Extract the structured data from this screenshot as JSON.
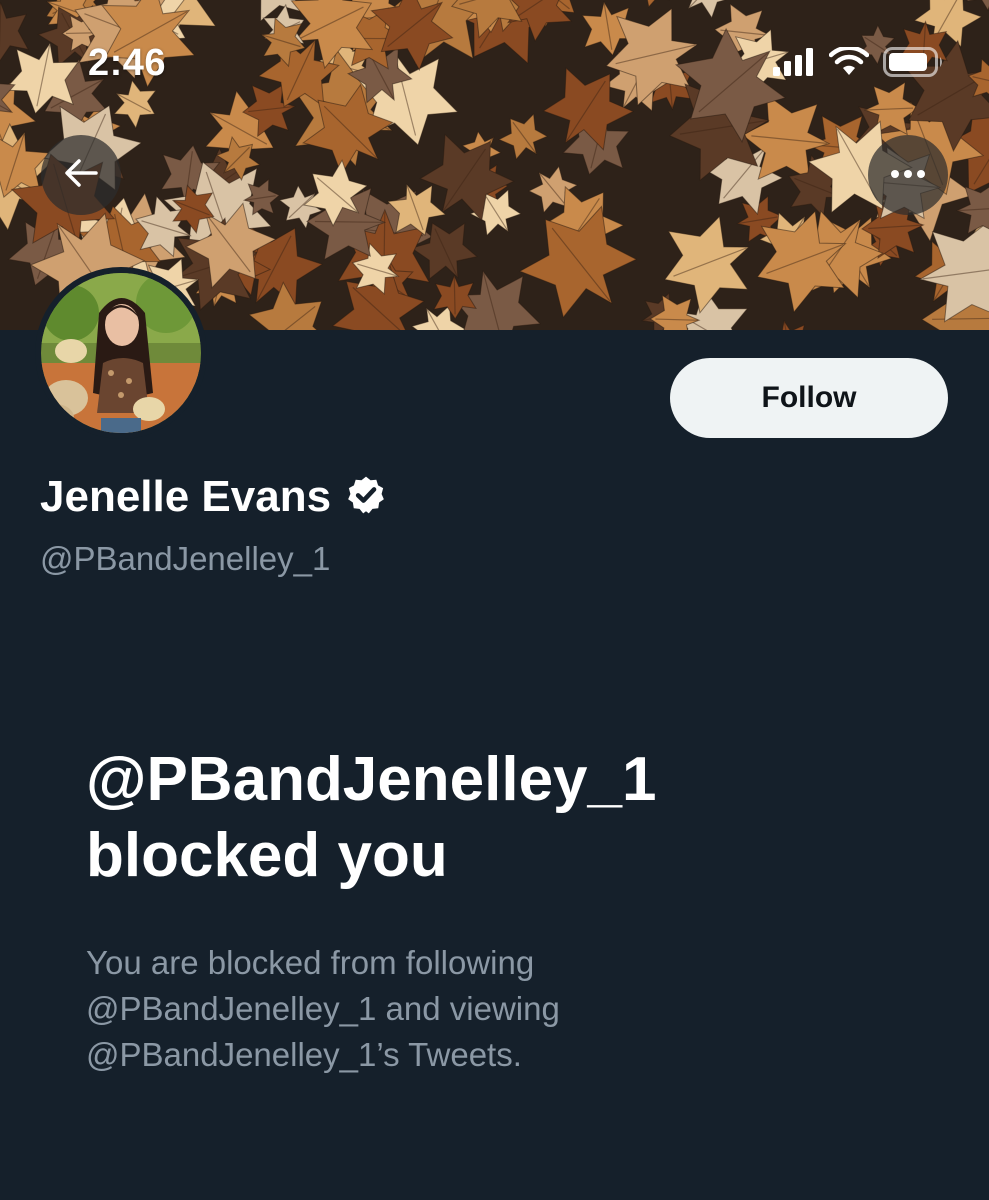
{
  "status_bar": {
    "time": "2:46",
    "icons": [
      "cellular-signal-icon",
      "wifi-icon",
      "battery-icon"
    ]
  },
  "banner": {
    "description_icon": "autumn-leaves-banner-image"
  },
  "nav": {
    "back_icon": "arrow-left-icon",
    "more_icon": "more-horizontal-icon"
  },
  "profile": {
    "display_name": "Jenelle Evans",
    "verified_icon": "verified-badge-icon",
    "handle": "@PBandJenelley_1",
    "follow_label": "Follow"
  },
  "blocked": {
    "title_line1": "@PBandJenelley_1",
    "title_line2": "blocked you",
    "description_line1": "You are blocked from following",
    "description_line2": "@PBandJenelley_1 and viewing",
    "description_line3": "@PBandJenelley_1’s Tweets."
  },
  "colors": {
    "background": "#15202b",
    "primary_text": "#ffffff",
    "secondary_text": "#8b98a5",
    "follow_button_bg": "#eff3f4",
    "follow_button_text": "#0f1419"
  }
}
